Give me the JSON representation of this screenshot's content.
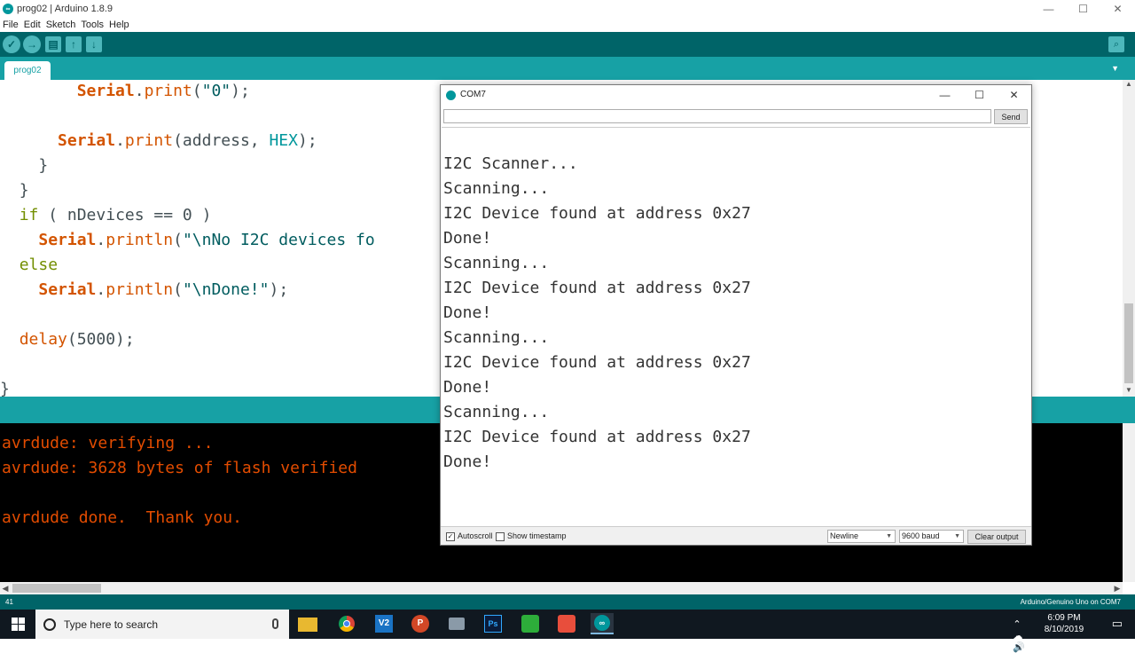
{
  "window": {
    "title": "prog02 | Arduino 1.8.9",
    "minimize": "—",
    "maximize": "☐",
    "close": "✕"
  },
  "menu": [
    "File",
    "Edit",
    "Sketch",
    "Tools",
    "Help"
  ],
  "toolbar": {
    "verify": "✓",
    "upload": "→",
    "new": "▤",
    "open": "↑",
    "save": "↓",
    "serial_monitor": "⌕"
  },
  "tabs": [
    {
      "label": "prog02"
    }
  ],
  "tab_menu": "▼",
  "editor": {
    "lines": [
      {
        "indent": "        ",
        "parts": [
          {
            "t": "Serial",
            "c": "kw"
          },
          {
            "t": ".",
            "c": ""
          },
          {
            "t": "print",
            "c": "fn"
          },
          {
            "t": "(",
            "c": ""
          },
          {
            "t": "\"0\"",
            "c": "str"
          },
          {
            "t": ");",
            "c": ""
          }
        ]
      },
      {
        "indent": "",
        "parts": []
      },
      {
        "indent": "      ",
        "parts": [
          {
            "t": "Serial",
            "c": "kw"
          },
          {
            "t": ".",
            "c": ""
          },
          {
            "t": "print",
            "c": "fn"
          },
          {
            "t": "(address, ",
            "c": ""
          },
          {
            "t": "HEX",
            "c": "cst"
          },
          {
            "t": ");",
            "c": ""
          }
        ]
      },
      {
        "indent": "    ",
        "parts": [
          {
            "t": "}",
            "c": ""
          }
        ]
      },
      {
        "indent": "  ",
        "parts": [
          {
            "t": "}",
            "c": ""
          }
        ]
      },
      {
        "indent": "  ",
        "parts": [
          {
            "t": "if",
            "c": "ctl"
          },
          {
            "t": " ( nDevices == 0 )",
            "c": ""
          }
        ]
      },
      {
        "indent": "    ",
        "parts": [
          {
            "t": "Serial",
            "c": "kw"
          },
          {
            "t": ".",
            "c": ""
          },
          {
            "t": "println",
            "c": "fn"
          },
          {
            "t": "(",
            "c": ""
          },
          {
            "t": "\"\\nNo I2C devices fo",
            "c": "str"
          }
        ]
      },
      {
        "indent": "  ",
        "parts": [
          {
            "t": "else",
            "c": "ctl"
          }
        ]
      },
      {
        "indent": "    ",
        "parts": [
          {
            "t": "Serial",
            "c": "kw"
          },
          {
            "t": ".",
            "c": ""
          },
          {
            "t": "println",
            "c": "fn"
          },
          {
            "t": "(",
            "c": ""
          },
          {
            "t": "\"\\nDone!\"",
            "c": "str"
          },
          {
            "t": ");",
            "c": ""
          }
        ]
      },
      {
        "indent": "",
        "parts": []
      },
      {
        "indent": "  ",
        "parts": [
          {
            "t": "delay",
            "c": "fn"
          },
          {
            "t": "(5000);",
            "c": ""
          }
        ]
      },
      {
        "indent": "",
        "parts": []
      },
      {
        "indent": "",
        "parts": [
          {
            "t": "}",
            "c": ""
          }
        ]
      }
    ]
  },
  "console": {
    "lines": [
      "avrdude: verifying ...",
      "avrdude: 3628 bytes of flash verified",
      "",
      "avrdude done.  Thank you."
    ]
  },
  "status": {
    "line_number": "41",
    "board": "Arduino/Genuino Uno on COM7"
  },
  "serial_monitor": {
    "title": "COM7",
    "input_value": "",
    "send_label": "Send",
    "output": [
      "",
      "I2C Scanner...",
      "Scanning...",
      "I2C Device found at address 0x27",
      "Done!",
      "Scanning...",
      "I2C Device found at address 0x27",
      "Done!",
      "Scanning...",
      "I2C Device found at address 0x27",
      "Done!",
      "Scanning...",
      "I2C Device found at address 0x27",
      "Done!"
    ],
    "autoscroll_label": "Autoscroll",
    "autoscroll_checked": true,
    "timestamp_label": "Show timestamp",
    "timestamp_checked": false,
    "line_ending": "Newline",
    "baud": "9600 baud",
    "clear_label": "Clear output"
  },
  "taskbar": {
    "search_placeholder": "Type here to search",
    "apps": [
      "file-explorer",
      "chrome",
      "vectorworks",
      "powerpoint",
      "camera",
      "photoshop",
      "camtasia",
      "camtasia-recorder",
      "arduino"
    ],
    "time": "6:09 PM",
    "date": "8/10/2019"
  },
  "colors": {
    "teal_dark": "#006468",
    "teal": "#17a1a5",
    "console_text": "#e34c00"
  }
}
